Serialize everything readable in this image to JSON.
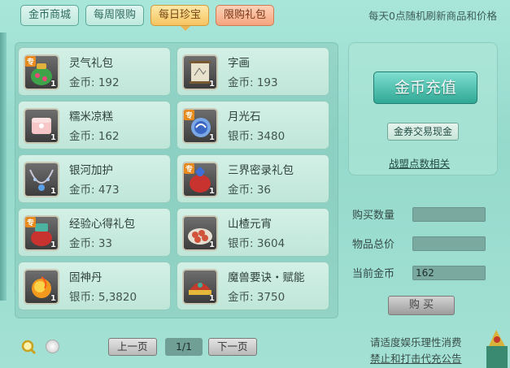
{
  "tabs": [
    {
      "label": "金币商城"
    },
    {
      "label": "每周限购"
    },
    {
      "label": "每日珍宝"
    },
    {
      "label": "限购礼包"
    }
  ],
  "notice": "每天0点随机刷新商品和价格",
  "items": [
    {
      "name": "灵气礼包",
      "price": "金币: 192",
      "qty": "1",
      "tag": "专",
      "icon": "spirit-bag-icon"
    },
    {
      "name": "字画",
      "price": "金币: 193",
      "qty": "1",
      "tag": "",
      "icon": "scroll-painting-icon"
    },
    {
      "name": "糯米凉糕",
      "price": "金币: 162",
      "qty": "1",
      "tag": "",
      "icon": "rice-cake-icon"
    },
    {
      "name": "月光石",
      "price": "银币: 3480",
      "qty": "1",
      "tag": "专",
      "icon": "moonstone-icon"
    },
    {
      "name": "银河加护",
      "price": "金币: 473",
      "qty": "1",
      "tag": "",
      "icon": "galaxy-necklace-icon"
    },
    {
      "name": "三界密录礼包",
      "price": "金币: 36",
      "qty": "1",
      "tag": "专",
      "icon": "secret-record-bag-icon"
    },
    {
      "name": "经验心得礼包",
      "price": "金币: 33",
      "qty": "1",
      "tag": "专",
      "icon": "experience-bag-icon"
    },
    {
      "name": "山楂元宵",
      "price": "银币: 3604",
      "qty": "1",
      "tag": "",
      "icon": "hawthorn-dumpling-icon"
    },
    {
      "name": "固神丹",
      "price": "银币: 5,3820",
      "qty": "1",
      "tag": "",
      "icon": "fire-pill-icon"
    },
    {
      "name": "魔兽要诀・赋能",
      "price": "金币: 3750",
      "qty": "1",
      "tag": "",
      "icon": "beast-hat-icon"
    }
  ],
  "pager": {
    "prev": "上一页",
    "page": "1/1",
    "next": "下一页"
  },
  "right": {
    "charge": "金币充值",
    "exchange": "金券交易现金",
    "union": "战盟点数相关",
    "qty_label": "购买数量",
    "total_label": "物品总价",
    "current_label": "当前金币",
    "current_value": "162",
    "buy": "购 买"
  },
  "footer": {
    "line1": "请适度娱乐理性消费",
    "line2": "禁止和打击代充公告"
  }
}
